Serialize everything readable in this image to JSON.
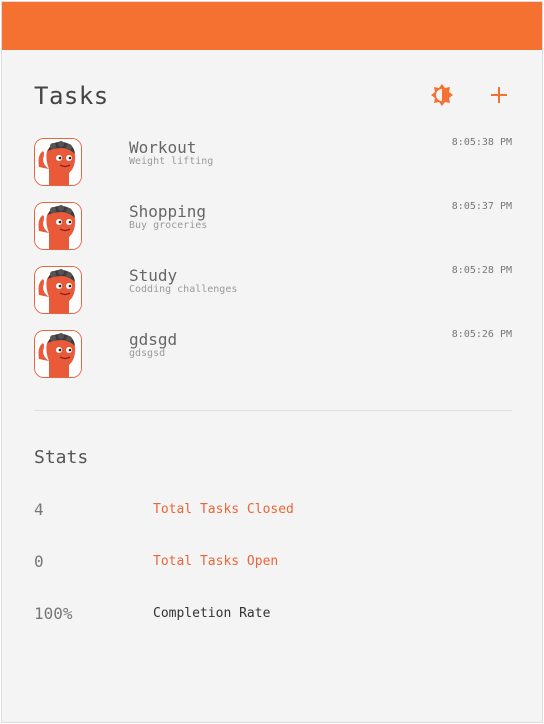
{
  "colors": {
    "accent": "#f47131",
    "stat_label_accent": "#e9663a",
    "stat_label_dark": "#333333"
  },
  "header": {
    "title": "Tasks",
    "theme_icon": "brightness-icon",
    "add_icon": "plus-icon"
  },
  "tasks": [
    {
      "title": "Workout",
      "subtitle": "Weight lifting",
      "time": "8:05:38 PM"
    },
    {
      "title": "Shopping",
      "subtitle": "Buy groceries",
      "time": "8:05:37 PM"
    },
    {
      "title": "Study",
      "subtitle": "Codding challenges",
      "time": "8:05:28 PM"
    },
    {
      "title": "gdsgd",
      "subtitle": "gdsgsd",
      "time": "8:05:26 PM"
    }
  ],
  "stats": {
    "title": "Stats",
    "items": [
      {
        "value": "4",
        "label": "Total Tasks Closed"
      },
      {
        "value": "0",
        "label": "Total Tasks Open"
      },
      {
        "value": "100%",
        "label": "Completion Rate"
      }
    ]
  }
}
